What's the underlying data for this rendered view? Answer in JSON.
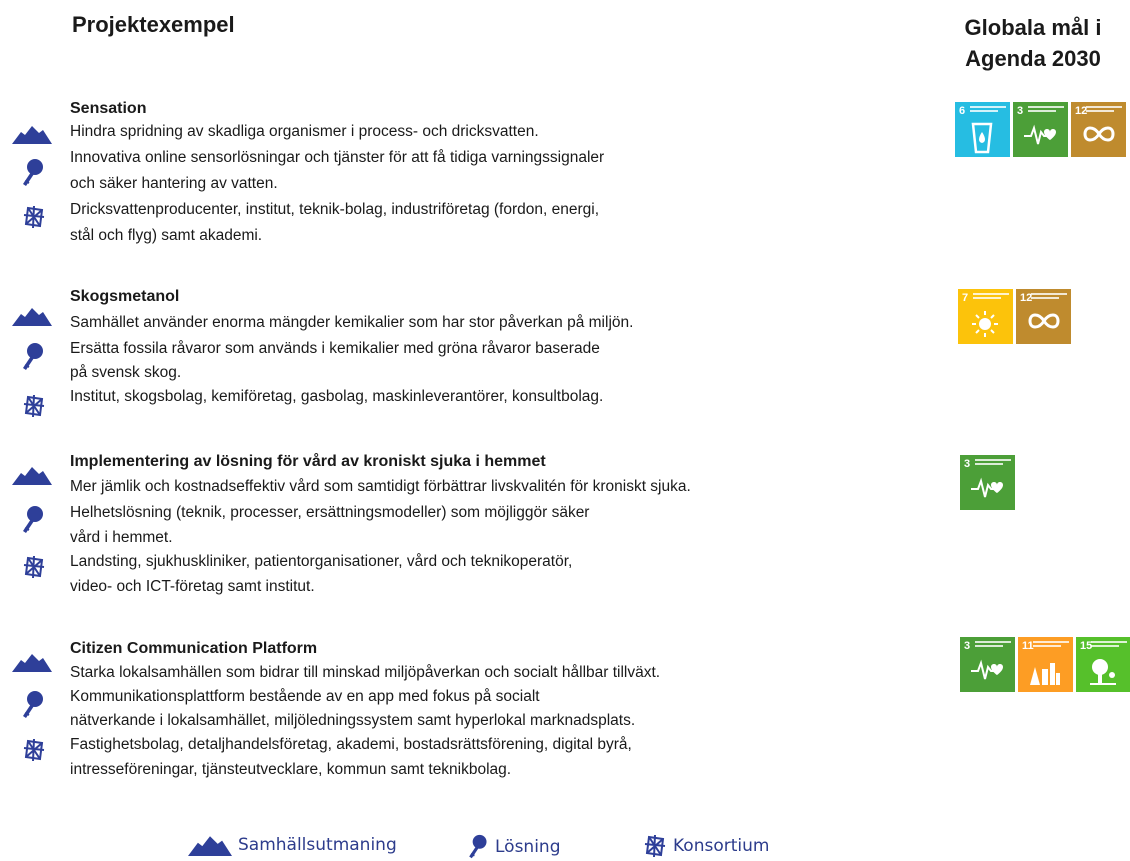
{
  "page": {
    "title": "Projektexempel",
    "goals_title_lines": [
      "Globala mål i",
      "Agenda 2030"
    ]
  },
  "colors": {
    "icon_blue": "#2e3f99",
    "sdg3": "#4c9f38",
    "sdg6": "#26bde2",
    "sdg7": "#fcc30b",
    "sdg11": "#fd9d24",
    "sdg12": "#bf8b2e",
    "sdg15": "#56c02b"
  },
  "projects": [
    {
      "title": "Sensation",
      "lines": [
        "Hindra spridning av skadliga organismer i process- och dricksvatten.",
        "Innovativa  online  sensorlösningar  och tjänster  för att få tidiga  varningssignaler",
        "och säker hantering av vatten.",
        "Dricksvattenproducenter,  institut,  teknik-bolag,  industriföretag  (fordon,  energi,",
        "stål och flyg) samt akademi."
      ],
      "goals": [
        {
          "number": "6",
          "color": "#26bde2",
          "icon": "water-drop-glass-icon"
        },
        {
          "number": "3",
          "color": "#4c9f38",
          "icon": "heartbeat-icon"
        },
        {
          "number": "12",
          "color": "#bf8b2e",
          "icon": "infinity-icon"
        }
      ]
    },
    {
      "title": "Skogsmetanol",
      "lines": [
        "Samhället  använder  enorma  mängder  kemikalier  som har stor påverkan på miljön.",
        "Ersätta fossila råvaror som används  i kemikalier  med gröna råvaror baserade",
        "på svensk  skog.",
        "Institut,  skogsbolag,  kemiföretag,  gasbolag,  maskinleverantörer,  konsultbolag."
      ],
      "goals": [
        {
          "number": "7",
          "color": "#fcc30b",
          "icon": "sun-power-icon"
        },
        {
          "number": "12",
          "color": "#bf8b2e",
          "icon": "infinity-icon"
        }
      ]
    },
    {
      "title": "Implementering  av lösning för vård av kroniskt sjuka i hemmet",
      "lines": [
        "Mer jämlik och kostnadseffektiv  vård som samtidigt förbättrar livskvalitén  för kroniskt sjuka.",
        "Helhetslösning  (teknik, processer, ersättningsmodeller)  som  möjliggör säker",
        "vård i hemmet.",
        "Landsting,  sjukhuskliniker,  patientorganisationer,  vård och teknikoperatör,",
        "video- och ICT-företag samt institut."
      ],
      "goals": [
        {
          "number": "3",
          "color": "#4c9f38",
          "icon": "heartbeat-icon"
        }
      ]
    },
    {
      "title": "Citizen Communication  Platform",
      "lines": [
        "Starka lokalsamhällen  som bidrar till minskad miljöpåverkan  och socialt hållbar tillväxt.",
        "Kommunikationsplattform  bestående  av en app med fokus på socialt",
        "nätverkande  i lokalsamhället,  miljöledningssystem  samt hyperlokal marknadsplats.",
        "Fastighetsbolag,  detaljhandelsföretag,  akademi,  bostadsrättsförening,  digital byrå,",
        "intresseföreningar,  tjänsteutvecklare,  kommun samt teknikbolag."
      ],
      "goals": [
        {
          "number": "3",
          "color": "#4c9f38",
          "icon": "heartbeat-icon"
        },
        {
          "number": "11",
          "color": "#fd9d24",
          "icon": "city-buildings-icon"
        },
        {
          "number": "15",
          "color": "#56c02b",
          "icon": "tree-icon"
        }
      ]
    }
  ],
  "legend": {
    "challenge_label": "Samhällsutmaning",
    "solution_label": "Lösning",
    "consortium_label": "Konsortium"
  }
}
